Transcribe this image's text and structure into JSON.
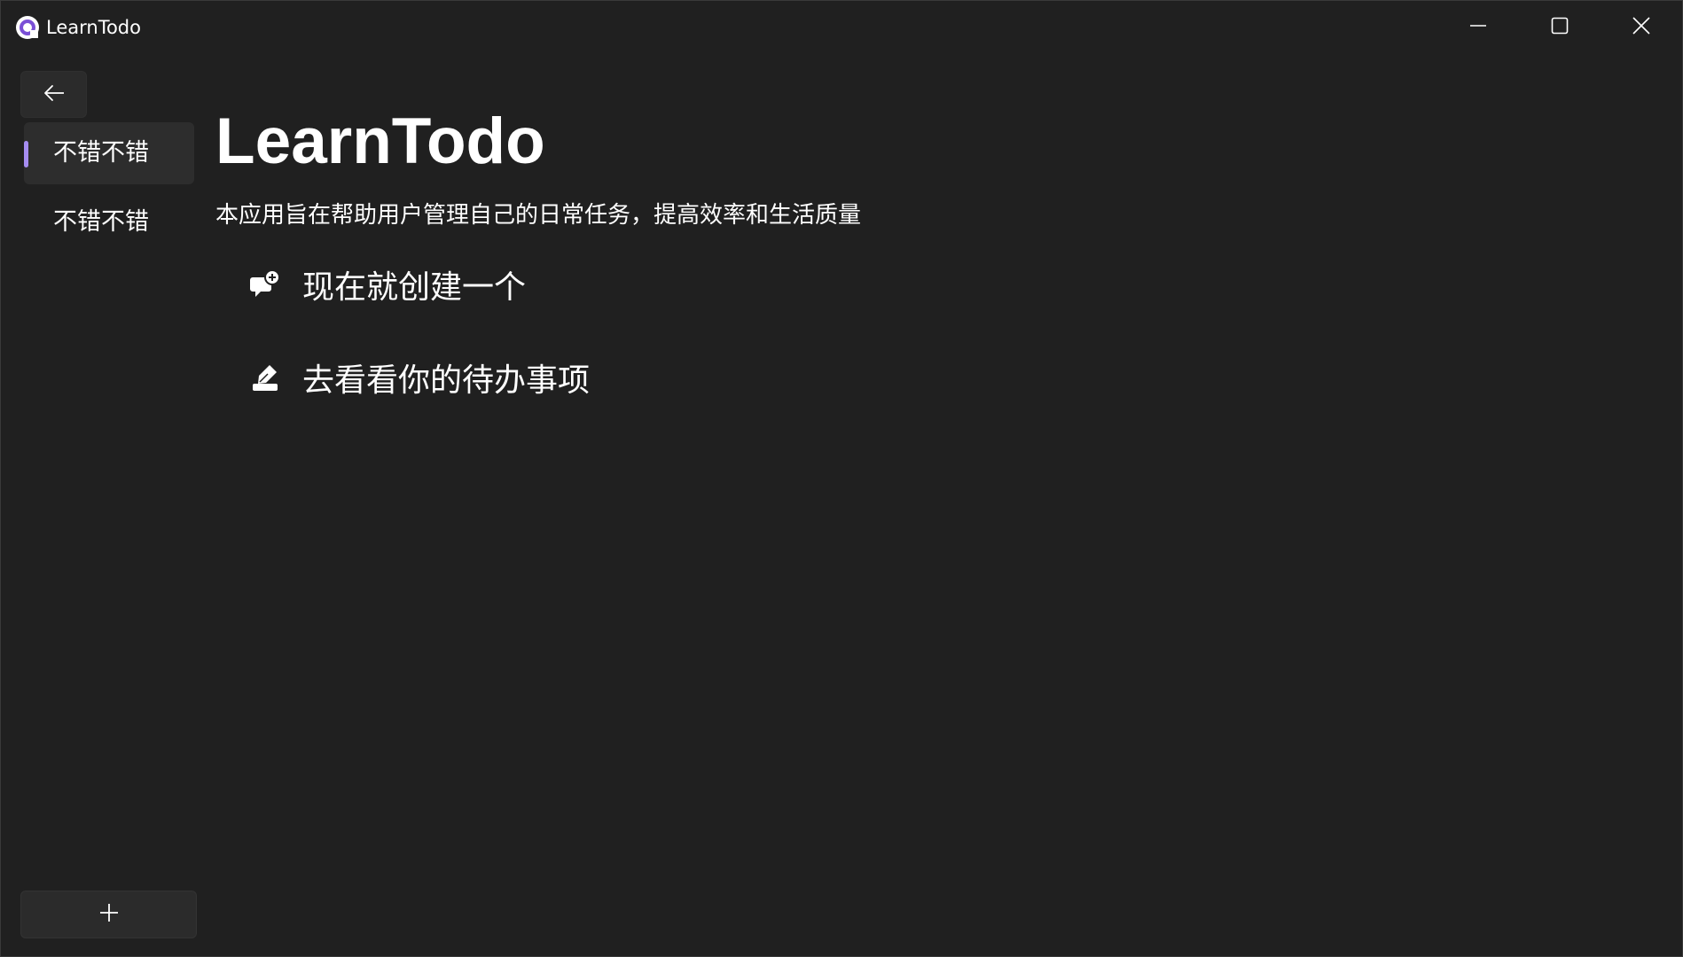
{
  "window": {
    "title": "LearnTodo",
    "controls": {
      "minimize": "minimize-icon",
      "maximize": "maximize-icon",
      "close": "close-icon"
    }
  },
  "sidebar": {
    "back_icon": "arrow-left-icon",
    "items": [
      {
        "label": "不错不错",
        "selected": true
      },
      {
        "label": "不错不错",
        "selected": false
      }
    ],
    "add_icon": "plus-icon",
    "accent_color": "#a58cf0"
  },
  "main": {
    "title": "LearnTodo",
    "subtitle": "本应用旨在帮助用户管理自己的日常任务，提高效率和生活质量",
    "actions": [
      {
        "icon": "chat-add-icon",
        "label": "现在就创建一个"
      },
      {
        "icon": "edit-icon",
        "label": "去看看你的待办事项"
      }
    ]
  },
  "colors": {
    "background": "#202020",
    "surface": "#2b2b2b",
    "text": "#ffffff"
  }
}
